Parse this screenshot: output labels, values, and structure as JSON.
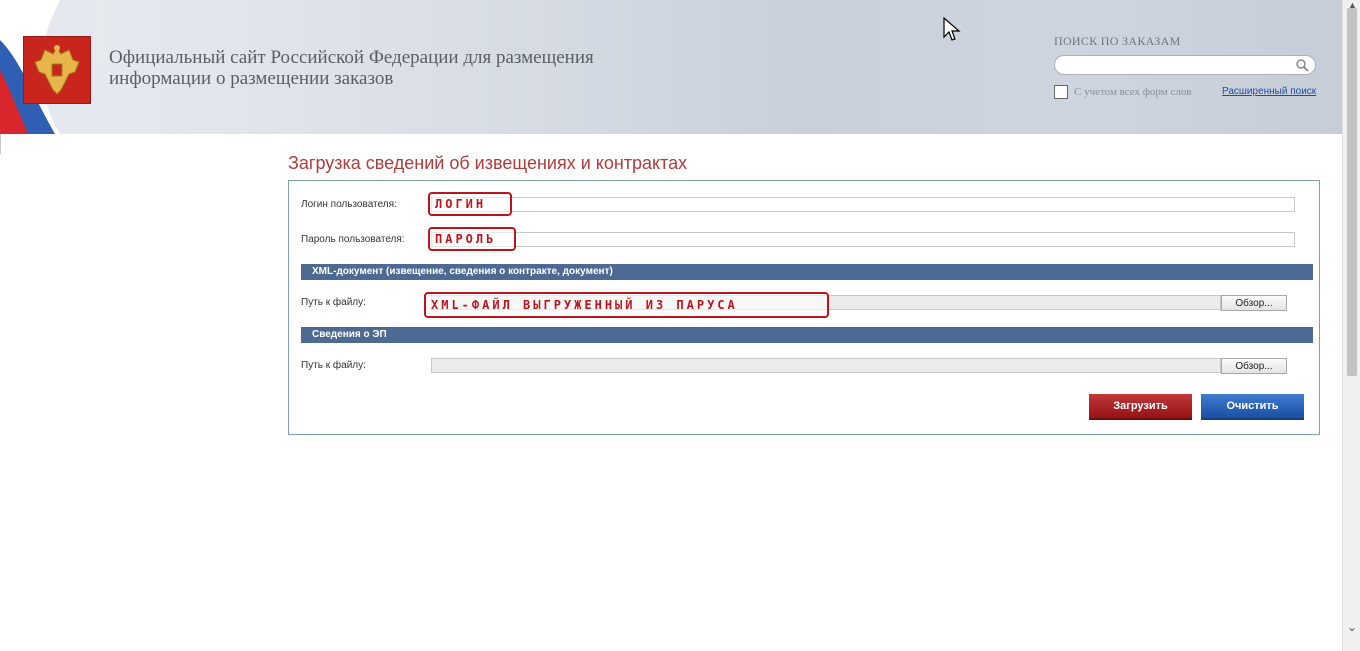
{
  "header": {
    "site_title_line1": "Официальный сайт Российской Федерации для размещения",
    "site_title_line2": "информации о размещении заказов",
    "search_label": "ПОИСК ПО ЗАКАЗАМ",
    "search_placeholder": "",
    "all_word_forms_label": "С учетом всех форм слов",
    "all_word_forms_checked": false,
    "advanced_search_link": "Расширенный поиск"
  },
  "page": {
    "title": "Загрузка сведений об извещениях и контрактах"
  },
  "form": {
    "login_label": "Логин пользователя:",
    "login_value": "",
    "password_label": "Пароль пользователя:",
    "password_value": "",
    "xml_section_title": "XML-документ (извещение, сведения о контракте, документ)",
    "xml_path_label": "Путь к файлу:",
    "xml_browse": "Обзор...",
    "ep_section_title": "Сведения о ЭП",
    "ep_path_label": "Путь к файлу:",
    "ep_browse": "Обзор...",
    "upload_button": "Загрузить",
    "clear_button": "Очистить"
  },
  "annotations": {
    "login": "ЛОГИН",
    "password": "ПАРОЛЬ",
    "xml_file": "XML-ФАЙЛ ВЫГРУЖЕННЫЙ ИЗ ПАРУСА"
  },
  "colors": {
    "title_red": "#b03c3c",
    "section_blue": "#4d6a93",
    "upload_red": "#a8201f",
    "clear_blue": "#2a62b8",
    "annotation_red": "#c0141c"
  }
}
